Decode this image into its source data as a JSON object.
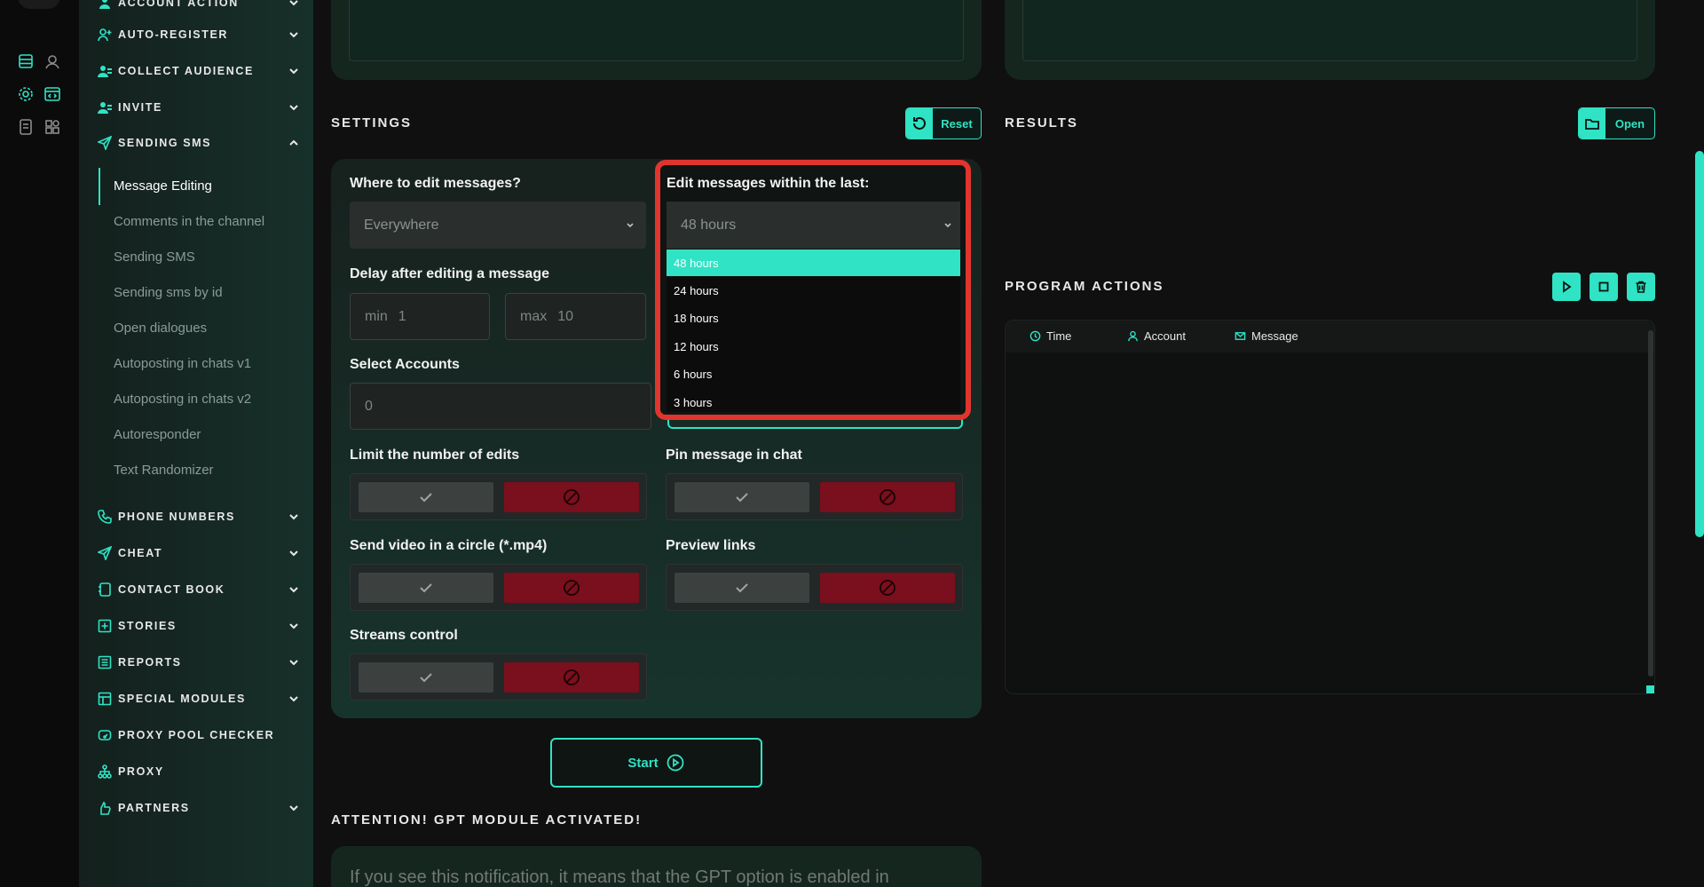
{
  "sidebar": {
    "top_item": "ACCOUNT ACTION",
    "sections": [
      {
        "label": "AUTO-REGISTER",
        "icon": "user-plus-icon"
      },
      {
        "label": "COLLECT AUDIENCE",
        "icon": "users-icon"
      },
      {
        "label": "INVITE",
        "icon": "users-icon"
      },
      {
        "label": "SENDING SMS",
        "icon": "send-icon"
      },
      {
        "label": "PHONE NUMBERS",
        "icon": "phone-icon"
      },
      {
        "label": "CHEAT",
        "icon": "send-icon"
      },
      {
        "label": "CONTACT BOOK",
        "icon": "book-icon"
      },
      {
        "label": "STORIES",
        "icon": "plus-square-icon"
      },
      {
        "label": "REPORTS",
        "icon": "report-icon"
      },
      {
        "label": "SPECIAL MODULES",
        "icon": "modules-icon"
      },
      {
        "label": "PROXY POOL CHECKER",
        "icon": "gauge-icon"
      },
      {
        "label": "PROXY",
        "icon": "network-icon"
      },
      {
        "label": "PARTNERS",
        "icon": "hand-icon"
      }
    ],
    "sms_items": [
      "Message Editing",
      "Comments in the channel",
      "Sending SMS",
      "Sending sms by id",
      "Open dialogues",
      "Autoposting in chats v1",
      "Autoposting in chats v2",
      "Autoresponder",
      "Text Randomizer"
    ]
  },
  "settings": {
    "title": "SETTINGS",
    "reset_label": "Reset",
    "where_label": "Where to edit messages?",
    "where_value": "Everywhere",
    "within_label": "Edit messages within the last:",
    "within_value": "48 hours",
    "within_options": [
      "48 hours",
      "24 hours",
      "18 hours",
      "12 hours",
      "6 hours",
      "3 hours"
    ],
    "delay_label": "Delay after editing a message",
    "delay_min_prefix": "min",
    "delay_min": "1",
    "delay_max_prefix": "max",
    "delay_max": "10",
    "accounts_label": "Select Accounts",
    "accounts_value": "0",
    "limit_label": "Limit the number of edits",
    "pin_label": "Pin message in chat",
    "video_label": "Send video in a circle (*.mp4)",
    "preview_label": "Preview links",
    "streams_label": "Streams control"
  },
  "start_label": "Start",
  "attention_title": "ATTENTION! GPT MODULE ACTIVATED!",
  "attention_text": "If you see this notification, it means that the GPT option is enabled in",
  "results": {
    "title": "RESULTS",
    "open_label": "Open"
  },
  "program_actions": {
    "title": "PROGRAM ACTIONS",
    "columns": [
      "Time",
      "Account",
      "Message"
    ]
  },
  "colors": {
    "accent": "#2fe3c4",
    "danger": "#7a0f1d",
    "highlight": "#e0352d"
  }
}
